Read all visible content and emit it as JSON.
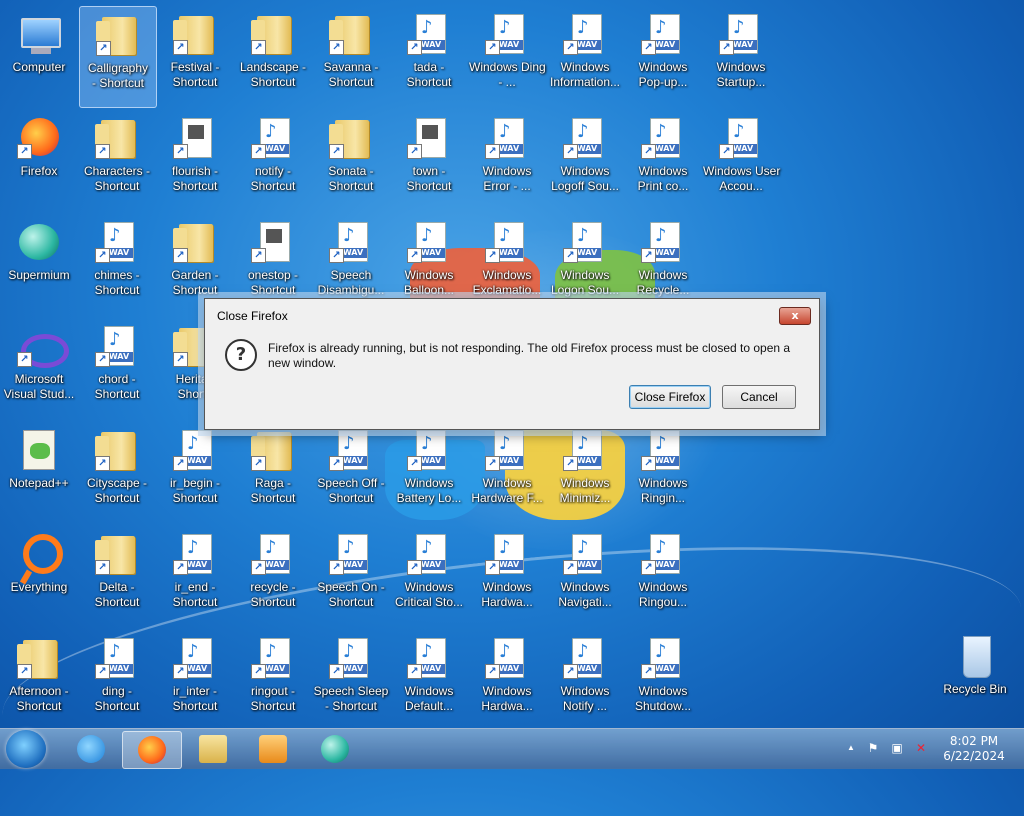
{
  "desktop": {
    "icons": [
      {
        "label": "Computer",
        "kind": "computer",
        "col": 0,
        "row": 0
      },
      {
        "label": "Calligraphy - Shortcut",
        "kind": "folder",
        "col": 1,
        "row": 0,
        "selected": true
      },
      {
        "label": "Festival - Shortcut",
        "kind": "folder",
        "col": 2,
        "row": 0
      },
      {
        "label": "Landscape - Shortcut",
        "kind": "folder",
        "col": 3,
        "row": 0
      },
      {
        "label": "Savanna - Shortcut",
        "kind": "folder",
        "col": 4,
        "row": 0
      },
      {
        "label": "tada - Shortcut",
        "kind": "wav",
        "col": 5,
        "row": 0
      },
      {
        "label": "Windows Ding - ...",
        "kind": "wav",
        "col": 6,
        "row": 0
      },
      {
        "label": "Windows Information...",
        "kind": "wav",
        "col": 7,
        "row": 0
      },
      {
        "label": "Windows Pop-up...",
        "kind": "wav",
        "col": 8,
        "row": 0
      },
      {
        "label": "Windows Startup...",
        "kind": "wav",
        "col": 9,
        "row": 0
      },
      {
        "label": "Firefox",
        "kind": "firefox",
        "col": 0,
        "row": 1
      },
      {
        "label": "Characters - Shortcut",
        "kind": "folder",
        "col": 1,
        "row": 1
      },
      {
        "label": "flourish - Shortcut",
        "kind": "film",
        "col": 2,
        "row": 1
      },
      {
        "label": "notify - Shortcut",
        "kind": "wav",
        "col": 3,
        "row": 1
      },
      {
        "label": "Sonata - Shortcut",
        "kind": "folder",
        "col": 4,
        "row": 1
      },
      {
        "label": "town - Shortcut",
        "kind": "film",
        "col": 5,
        "row": 1
      },
      {
        "label": "Windows Error - ...",
        "kind": "wav",
        "col": 6,
        "row": 1
      },
      {
        "label": "Windows Logoff Sou...",
        "kind": "wav",
        "col": 7,
        "row": 1
      },
      {
        "label": "Windows Print co...",
        "kind": "wav",
        "col": 8,
        "row": 1
      },
      {
        "label": "Windows User Accou...",
        "kind": "wav",
        "col": 9,
        "row": 1
      },
      {
        "label": "Supermium",
        "kind": "supermium",
        "col": 0,
        "row": 2
      },
      {
        "label": "chimes - Shortcut",
        "kind": "wav",
        "col": 1,
        "row": 2
      },
      {
        "label": "Garden - Shortcut",
        "kind": "folder",
        "col": 2,
        "row": 2
      },
      {
        "label": "onestop - Shortcut",
        "kind": "film",
        "col": 3,
        "row": 2
      },
      {
        "label": "Speech Disambigu...",
        "kind": "wav",
        "col": 4,
        "row": 2
      },
      {
        "label": "Windows Balloon...",
        "kind": "wav",
        "col": 5,
        "row": 2
      },
      {
        "label": "Windows Exclamatio...",
        "kind": "wav",
        "col": 6,
        "row": 2
      },
      {
        "label": "Windows Logon Sou...",
        "kind": "wav",
        "col": 7,
        "row": 2
      },
      {
        "label": "Windows Recycle...",
        "kind": "wav",
        "col": 8,
        "row": 2
      },
      {
        "label": "Microsoft Visual Stud...",
        "kind": "vs",
        "col": 0,
        "row": 3
      },
      {
        "label": "chord - Shortcut",
        "kind": "wav",
        "col": 1,
        "row": 3
      },
      {
        "label": "Heritag Shortc",
        "kind": "folder",
        "col": 2,
        "row": 3
      },
      {
        "label": "Notepad++",
        "kind": "notepad",
        "col": 0,
        "row": 4
      },
      {
        "label": "Cityscape - Shortcut",
        "kind": "folder",
        "col": 1,
        "row": 4
      },
      {
        "label": "ir_begin - Shortcut",
        "kind": "wav",
        "col": 2,
        "row": 4
      },
      {
        "label": "Raga - Shortcut",
        "kind": "folder",
        "col": 3,
        "row": 4
      },
      {
        "label": "Speech Off - Shortcut",
        "kind": "wav",
        "col": 4,
        "row": 4
      },
      {
        "label": "Windows Battery Lo...",
        "kind": "wav",
        "col": 5,
        "row": 4
      },
      {
        "label": "Windows Hardware F...",
        "kind": "wav",
        "col": 6,
        "row": 4
      },
      {
        "label": "Windows Minimiz...",
        "kind": "wav",
        "col": 7,
        "row": 4
      },
      {
        "label": "Windows Ringin...",
        "kind": "wav",
        "col": 8,
        "row": 4
      },
      {
        "label": "Everything",
        "kind": "everything",
        "col": 0,
        "row": 5
      },
      {
        "label": "Delta - Shortcut",
        "kind": "folder",
        "col": 1,
        "row": 5
      },
      {
        "label": "ir_end - Shortcut",
        "kind": "wav",
        "col": 2,
        "row": 5
      },
      {
        "label": "recycle - Shortcut",
        "kind": "wav",
        "col": 3,
        "row": 5
      },
      {
        "label": "Speech On - Shortcut",
        "kind": "wav",
        "col": 4,
        "row": 5
      },
      {
        "label": "Windows Critical Sto...",
        "kind": "wav",
        "col": 5,
        "row": 5
      },
      {
        "label": "Windows Hardwa...",
        "kind": "wav",
        "col": 6,
        "row": 5
      },
      {
        "label": "Windows Navigati...",
        "kind": "wav",
        "col": 7,
        "row": 5
      },
      {
        "label": "Windows Ringou...",
        "kind": "wav",
        "col": 8,
        "row": 5
      },
      {
        "label": "Afternoon - Shortcut",
        "kind": "folder",
        "col": 0,
        "row": 6
      },
      {
        "label": "ding - Shortcut",
        "kind": "wav",
        "col": 1,
        "row": 6
      },
      {
        "label": "ir_inter - Shortcut",
        "kind": "wav",
        "col": 2,
        "row": 6
      },
      {
        "label": "ringout - Shortcut",
        "kind": "wav",
        "col": 3,
        "row": 6
      },
      {
        "label": "Speech Sleep - Shortcut",
        "kind": "wav",
        "col": 4,
        "row": 6
      },
      {
        "label": "Windows Default...",
        "kind": "wav",
        "col": 5,
        "row": 6
      },
      {
        "label": "Windows Hardwa...",
        "kind": "wav",
        "col": 6,
        "row": 6
      },
      {
        "label": "Windows Notify ...",
        "kind": "wav",
        "col": 7,
        "row": 6
      },
      {
        "label": "Windows Shutdow...",
        "kind": "wav",
        "col": 8,
        "row": 6
      }
    ],
    "recycle_bin": {
      "label": "Recycle Bin"
    },
    "wav_tag": "WAV"
  },
  "dialog": {
    "title": "Close Firefox",
    "close_glyph": "x",
    "question_glyph": "?",
    "message": "Firefox is already running, but is not responding. The old Firefox process must be closed to open a new window.",
    "primary_button": "Close Firefox",
    "cancel_button": "Cancel"
  },
  "taskbar": {
    "pinned": [
      {
        "name": "internet-explorer",
        "active": false
      },
      {
        "name": "firefox",
        "active": true
      },
      {
        "name": "file-explorer",
        "active": false
      },
      {
        "name": "media-player",
        "active": false
      },
      {
        "name": "supermium",
        "active": false
      }
    ],
    "tray": {
      "show_hidden": "▲",
      "flag": "⚑",
      "network": "▣",
      "volume": "✕"
    },
    "clock": {
      "time": "8:02 PM",
      "date": "6/22/2024"
    }
  }
}
